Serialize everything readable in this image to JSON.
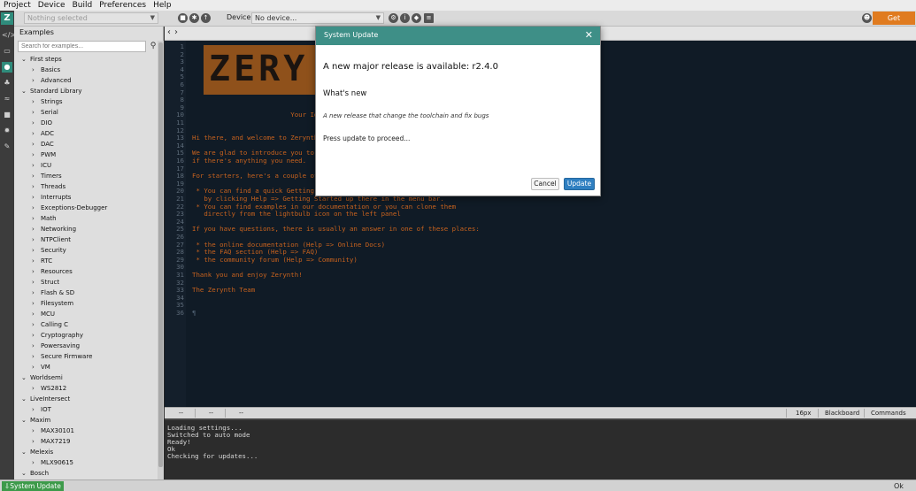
{
  "menubar": {
    "items": [
      "Project",
      "Device",
      "Build",
      "Preferences",
      "Help"
    ]
  },
  "toolbar": {
    "project_placeholder": "Nothing selected",
    "device_label": "Device:",
    "device_value": "No device...",
    "licenses_label": "Get Licenses"
  },
  "sidebar": {
    "title": "Examples",
    "search_placeholder": "Search for examples...",
    "tree": [
      {
        "label": "First steps",
        "level": 1,
        "expanded": true
      },
      {
        "label": "Basics",
        "level": 2,
        "expanded": false
      },
      {
        "label": "Advanced",
        "level": 2,
        "expanded": false
      },
      {
        "label": "Standard Library",
        "level": 1,
        "expanded": true
      },
      {
        "label": "Strings",
        "level": 2,
        "expanded": false
      },
      {
        "label": "Serial",
        "level": 2,
        "expanded": false
      },
      {
        "label": "DIO",
        "level": 2,
        "expanded": false
      },
      {
        "label": "ADC",
        "level": 2,
        "expanded": false
      },
      {
        "label": "DAC",
        "level": 2,
        "expanded": false
      },
      {
        "label": "PWM",
        "level": 2,
        "expanded": false
      },
      {
        "label": "ICU",
        "level": 2,
        "expanded": false
      },
      {
        "label": "Timers",
        "level": 2,
        "expanded": false
      },
      {
        "label": "Threads",
        "level": 2,
        "expanded": false
      },
      {
        "label": "Interrupts",
        "level": 2,
        "expanded": false
      },
      {
        "label": "Exceptions-Debugger",
        "level": 2,
        "expanded": false
      },
      {
        "label": "Math",
        "level": 2,
        "expanded": false
      },
      {
        "label": "Networking",
        "level": 2,
        "expanded": false
      },
      {
        "label": "NTPClient",
        "level": 2,
        "expanded": false
      },
      {
        "label": "Security",
        "level": 2,
        "expanded": false
      },
      {
        "label": "RTC",
        "level": 2,
        "expanded": false
      },
      {
        "label": "Resources",
        "level": 2,
        "expanded": false
      },
      {
        "label": "Struct",
        "level": 2,
        "expanded": false
      },
      {
        "label": "Flash & SD",
        "level": 2,
        "expanded": false
      },
      {
        "label": "Filesystem",
        "level": 2,
        "expanded": false
      },
      {
        "label": "MCU",
        "level": 2,
        "expanded": false
      },
      {
        "label": "Calling C",
        "level": 2,
        "expanded": false
      },
      {
        "label": "Cryptography",
        "level": 2,
        "expanded": false
      },
      {
        "label": "Powersaving",
        "level": 2,
        "expanded": false
      },
      {
        "label": "Secure Firmware",
        "level": 2,
        "expanded": false
      },
      {
        "label": "VM",
        "level": 2,
        "expanded": false
      },
      {
        "label": "Worldsemi",
        "level": 1,
        "expanded": true
      },
      {
        "label": "WS2812",
        "level": 2,
        "expanded": false
      },
      {
        "label": "LiveIntersect",
        "level": 1,
        "expanded": true
      },
      {
        "label": "IOT",
        "level": 2,
        "expanded": false
      },
      {
        "label": "Maxim",
        "level": 1,
        "expanded": true
      },
      {
        "label": "MAX30101",
        "level": 2,
        "expanded": false
      },
      {
        "label": "MAX7219",
        "level": 2,
        "expanded": false
      },
      {
        "label": "Melexis",
        "level": 1,
        "expanded": true
      },
      {
        "label": "MLX90615",
        "level": 2,
        "expanded": false
      },
      {
        "label": "Bosch",
        "level": 1,
        "expanded": true
      }
    ]
  },
  "editor": {
    "banner": "ZERY",
    "lines": [
      {
        "n": "1",
        "text": "",
        "style": "dim"
      },
      {
        "n": "2",
        "text": "",
        "style": "dim"
      },
      {
        "n": "3",
        "text": "",
        "style": "dim"
      },
      {
        "n": "4",
        "text": "",
        "style": "dim"
      },
      {
        "n": "5",
        "text": "",
        "style": "dim"
      },
      {
        "n": "6",
        "text": "",
        "style": "dim"
      },
      {
        "n": "7",
        "text": "",
        "style": "dim"
      },
      {
        "n": "8",
        "text": "",
        "style": "dim"
      },
      {
        "n": "9",
        "text": "",
        "style": "dim"
      },
      {
        "n": "10",
        "text": "                         Your Idea",
        "style": "code"
      },
      {
        "n": "11",
        "text": "",
        "style": "dim"
      },
      {
        "n": "12",
        "text": "",
        "style": "dim"
      },
      {
        "n": "13",
        "text": "Hi there, and welcome to Zerynth",
        "style": "code"
      },
      {
        "n": "14",
        "text": "",
        "style": "dim"
      },
      {
        "n": "15",
        "text": "We are glad to introduce you to",
        "style": "code"
      },
      {
        "n": "16",
        "text": "if there's anything you need.",
        "style": "code"
      },
      {
        "n": "17",
        "text": "",
        "style": "dim"
      },
      {
        "n": "18",
        "text": "For starters, here's a couple of",
        "style": "code"
      },
      {
        "n": "19",
        "text": "",
        "style": "dim"
      },
      {
        "n": "20",
        "text": " * You can find a quick Getting",
        "style": "code"
      },
      {
        "n": "21",
        "text": "   by clicking Help => Getting Started up there in the menu bar.",
        "style": "code"
      },
      {
        "n": "22",
        "text": " * You can find examples in our documentation or you can clone them",
        "style": "code"
      },
      {
        "n": "23",
        "text": "   directly from the lightbulb icon on the left panel",
        "style": "code"
      },
      {
        "n": "24",
        "text": "",
        "style": "dim"
      },
      {
        "n": "25",
        "text": "If you have questions, there is usually an answer in one of these places:",
        "style": "code"
      },
      {
        "n": "26",
        "text": "",
        "style": "dim"
      },
      {
        "n": "27",
        "text": " * the online documentation (Help => Online Docs)",
        "style": "code"
      },
      {
        "n": "28",
        "text": " * the FAQ section (Help => FAQ)",
        "style": "code"
      },
      {
        "n": "29",
        "text": " * the community forum (Help => Community)",
        "style": "code"
      },
      {
        "n": "30",
        "text": "",
        "style": "dim"
      },
      {
        "n": "31",
        "text": "Thank you and enjoy Zerynth!",
        "style": "code"
      },
      {
        "n": "32",
        "text": "",
        "style": "dim"
      },
      {
        "n": "33",
        "text": "The Zerynth Team",
        "style": "code"
      },
      {
        "n": "34",
        "text": "",
        "style": "dim"
      },
      {
        "n": "35",
        "text": "",
        "style": "dim"
      },
      {
        "n": "36",
        "text": "¶",
        "style": "dim"
      }
    ]
  },
  "editor_status": {
    "cells": [
      "--",
      "--",
      "--"
    ],
    "font_size": "16px",
    "theme": "Blackboard",
    "mode": "Commands"
  },
  "console": {
    "lines": [
      "Loading settings...",
      "Switched to auto mode",
      "Ready!",
      "Ok",
      "Checking for updates..."
    ]
  },
  "statusbar": {
    "update_label": "System Update",
    "right_text": "Ok"
  },
  "modal": {
    "title": "System Update",
    "heading": "A new major release is available: r2.4.0",
    "subheading": "What's new",
    "note": "A new release that change the toolchain and fix bugs",
    "proceed": "Press update to proceed...",
    "cancel_label": "Cancel",
    "update_label": "Update"
  },
  "colors": {
    "accent_teal": "#3e8f87",
    "update_blue": "#2f7fc1",
    "licenses_orange": "#e07b1f",
    "status_green": "#3d9a4a",
    "editor_bg": "#101b26",
    "code_orange": "#c7621e"
  }
}
